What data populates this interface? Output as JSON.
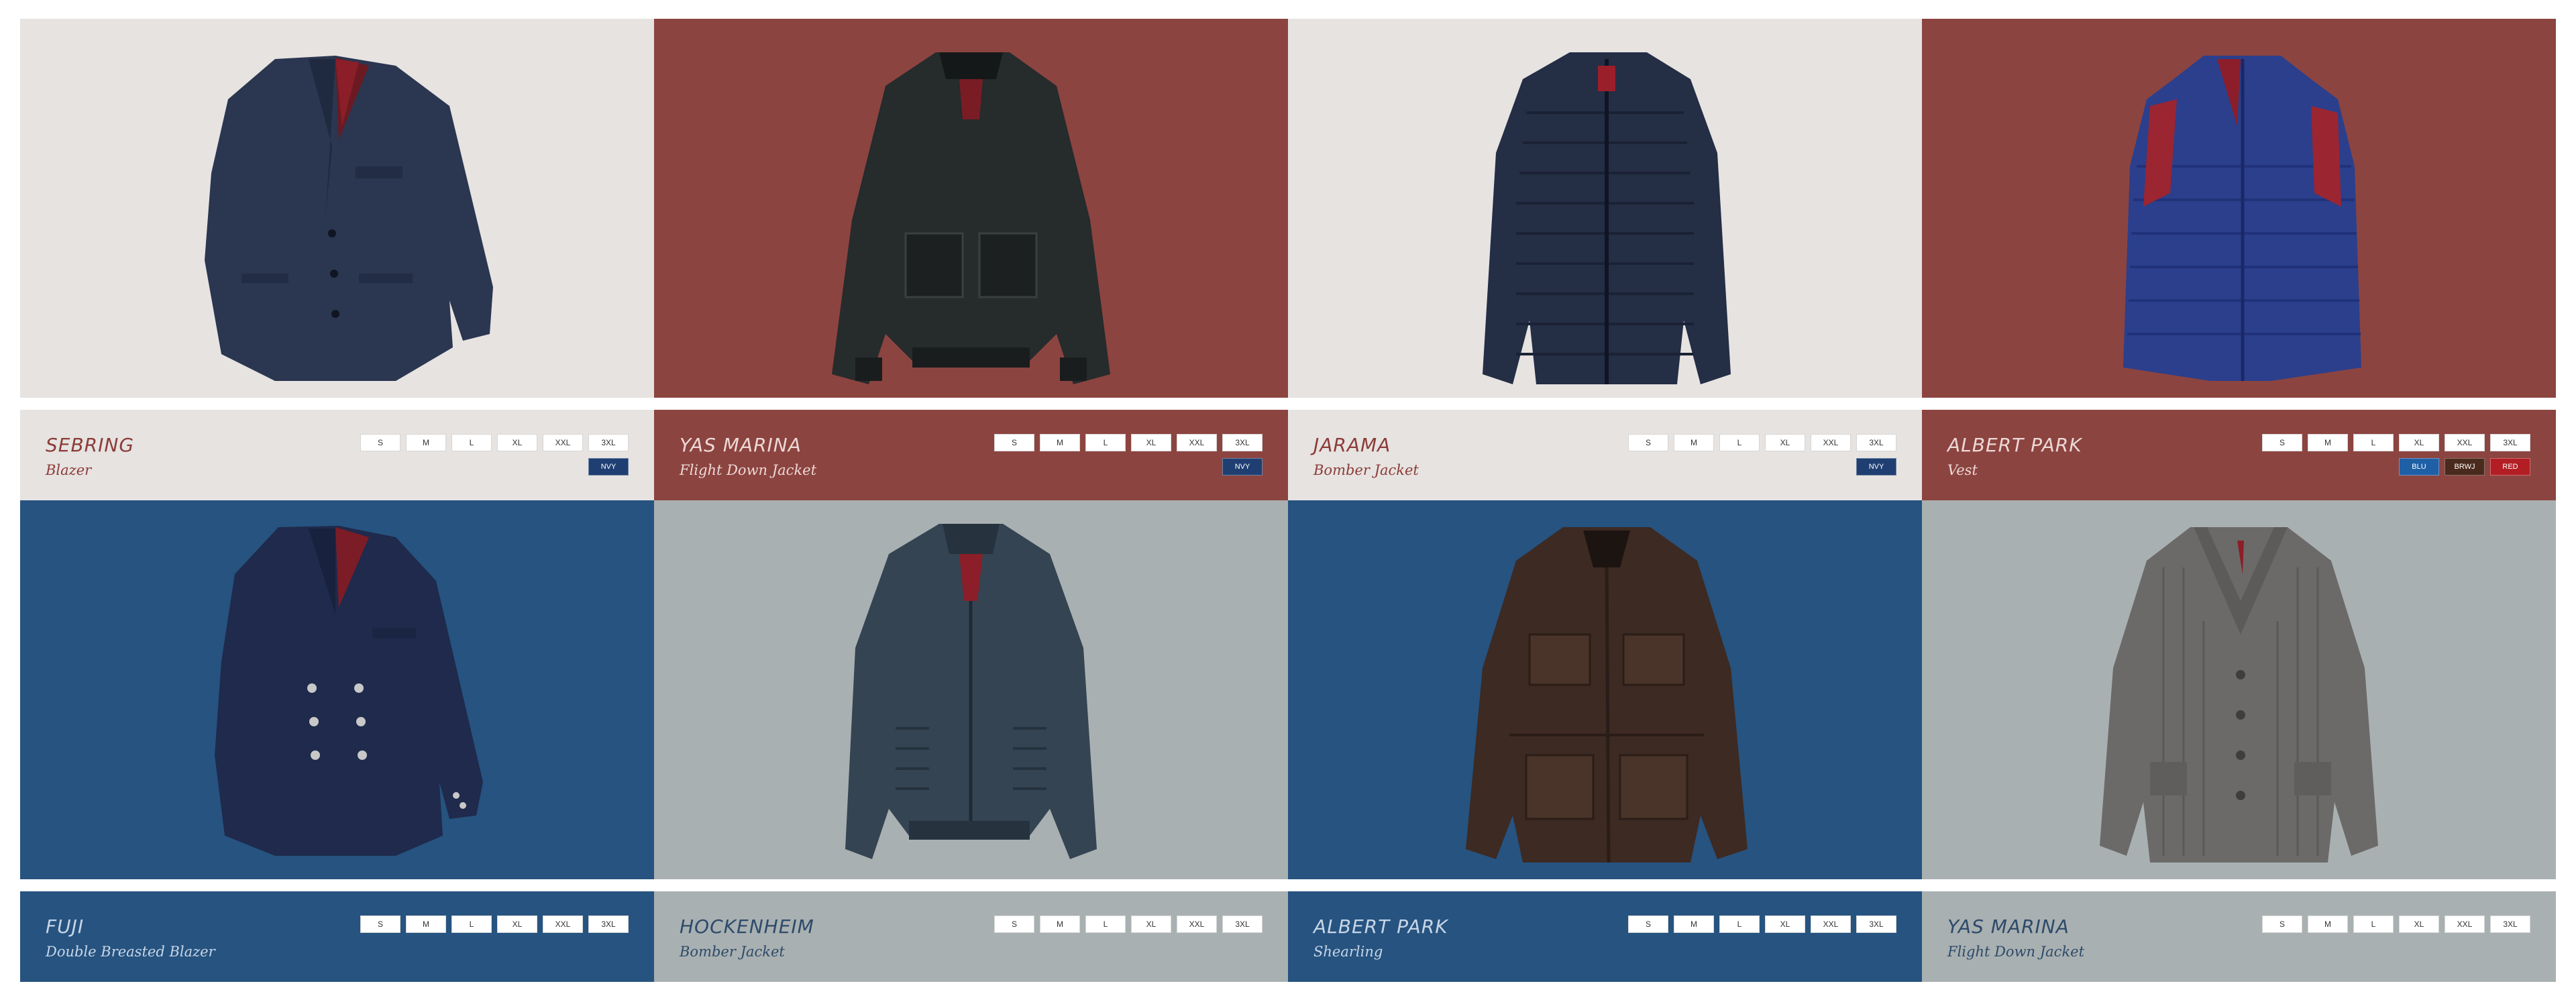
{
  "colors": {
    "panel_light": "#e6e3e1",
    "panel_rust": "#8c4440",
    "panel_blue": "#265380",
    "panel_grey": "#a9b0b1",
    "swatch_navy": "#1f3f72",
    "swatch_blue": "#1e5fa5",
    "swatch_brown": "#4a2a1c",
    "swatch_red": "#b31e24"
  },
  "sizes": [
    "S",
    "M",
    "L",
    "XL",
    "XXL",
    "3XL"
  ],
  "products": [
    {
      "name": "SEBRING",
      "type": "Blazer",
      "image": "navy-blazer-image",
      "colors": [
        {
          "label": "NVY",
          "hex": "#1f3f72"
        }
      ]
    },
    {
      "name": "YAS MARINA",
      "type": "Flight Down Jacket",
      "image": "black-leather-jacket-image",
      "colors": [
        {
          "label": "NVY",
          "hex": "#1f3f72"
        }
      ]
    },
    {
      "name": "JARAMA",
      "type": "Bomber Jacket",
      "image": "navy-puffer-jacket-image",
      "colors": [
        {
          "label": "NVY",
          "hex": "#1f3f72"
        }
      ]
    },
    {
      "name": "ALBERT PARK",
      "type": "Vest",
      "image": "blue-quilted-vest-image",
      "colors": [
        {
          "label": "BLU",
          "hex": "#1e5fa5"
        },
        {
          "label": "BRWJ",
          "hex": "#4a2a1c"
        },
        {
          "label": "RED",
          "hex": "#b31e24"
        }
      ]
    },
    {
      "name": "FUJI",
      "type": "Double Breasted Blazer",
      "image": "navy-double-breasted-blazer-image",
      "colors": []
    },
    {
      "name": "HOCKENHEIM",
      "type": "Bomber Jacket",
      "image": "slate-bomber-jacket-image",
      "colors": []
    },
    {
      "name": "ALBERT PARK",
      "type": "Shearling",
      "image": "brown-suede-jacket-image",
      "colors": []
    },
    {
      "name": "YAS MARINA",
      "type": "Flight Down Jacket",
      "image": "grey-knit-cardigan-image",
      "colors": []
    }
  ]
}
